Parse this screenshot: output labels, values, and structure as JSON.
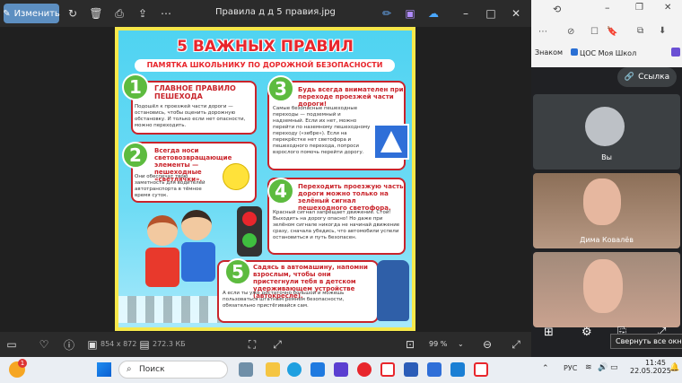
{
  "viewer": {
    "edit_label": "Изменить",
    "title": "Правила д д 5 правия.jpg",
    "dimensions": "854 x 872",
    "filesize": "272.3 КБ",
    "zoom": "99 %"
  },
  "poster": {
    "title": "5 ВАЖНЫХ ПРАВИЛ",
    "subtitle": "ПАМЯТКА ШКОЛЬНИКУ ПО ДОРОЖНОЙ БЕЗОПАСНОСТИ",
    "rules": [
      {
        "num": "1",
        "head": "ГЛАВНОЕ ПРАВИЛО ПЕШЕХОДА",
        "text": "Подошёл к проезжей части дороги — остановись, чтобы оценить дорожную обстановку. И только если нет опасности, можно переходить."
      },
      {
        "num": "2",
        "head": "Всегда носи световозвращающие элементы — пешеходные «светлячки».",
        "text": "Они обеспечат твою заметность для водителей автотранспорта в тёмное время суток."
      },
      {
        "num": "3",
        "head": "Будь всегда внимателен при переходе проезжей части дороги!",
        "text": "Самые безопасные пешеходные переходы — подземный и надземный. Если их нет, можно перейти по наземному пешеходному переходу («зебре»). Если на перекрёстке нет светофора и пешеходного перехода, попроси взрослого помочь перейти дорогу."
      },
      {
        "num": "4",
        "head": "Переходить проезжую часть дороги можно только на зелёный сигнал пешеходного светофора.",
        "text": "Красный сигнал запрещает движение. Стой! Выходить на дорогу опасно! Но даже при зелёном сигнале никогда не начинай движение сразу, сначала убедись, что автомобили успели остановиться и путь безопасен."
      },
      {
        "num": "5",
        "head": "Садясь в автомашину, напомни взрослым, чтобы они пристегнули тебя в детском удерживающем устройстве (автокресле).",
        "text": "А если ты уже достаточно большой и можешь пользоваться штатным ремнём безопасности, обязательно пристёгивайся сам."
      }
    ]
  },
  "browser": {
    "bookmark1": "Знаком",
    "bookmark2": "ЦОС Моя Школ",
    "link_label": "Ссылка"
  },
  "call": {
    "you": "Вы",
    "participant": "Дима Ковалёв",
    "tooltip": "Свернуть все окна"
  },
  "taskbar": {
    "search": "Поиск",
    "lang": "РУС",
    "time": "11:45",
    "date": "22.05.2025",
    "badge": "1"
  }
}
